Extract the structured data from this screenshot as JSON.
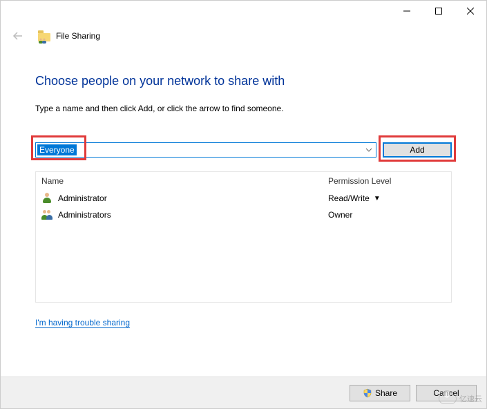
{
  "window": {
    "title": "File Sharing"
  },
  "page": {
    "heading": "Choose people on your network to share with",
    "subtext": "Type a name and then click Add, or click the arrow to find someone."
  },
  "combo": {
    "value": "Everyone"
  },
  "buttons": {
    "add": "Add",
    "share": "Share",
    "cancel": "Cancel"
  },
  "table": {
    "headers": {
      "name": "Name",
      "permission": "Permission Level"
    },
    "rows": [
      {
        "name": "Administrator",
        "permission": "Read/Write",
        "has_dropdown": true,
        "type": "user"
      },
      {
        "name": "Administrators",
        "permission": "Owner",
        "has_dropdown": false,
        "type": "group"
      }
    ]
  },
  "links": {
    "trouble": "I'm having trouble sharing"
  },
  "watermark": "亿速云"
}
